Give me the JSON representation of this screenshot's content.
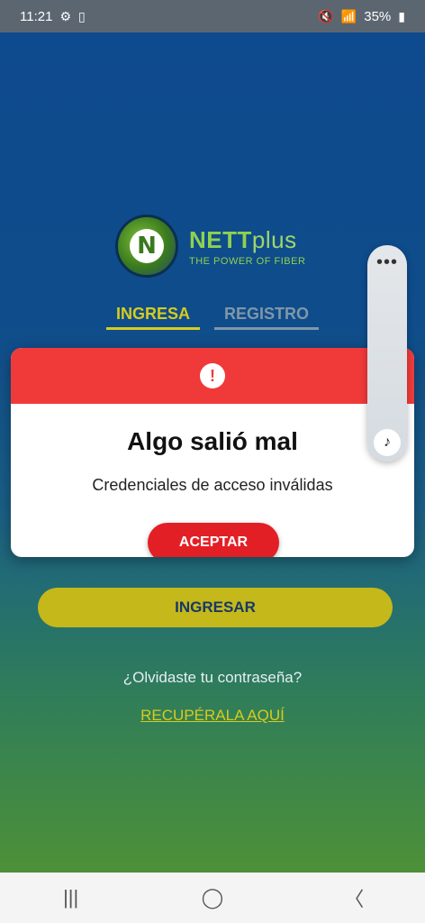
{
  "status_bar": {
    "time": "11:21",
    "settings_icon": "gear-icon",
    "sim_icon": "sim-icon",
    "mute_icon": "mute-icon",
    "wifi_icon": "wifi-icon",
    "signal_icon": "signal-icon",
    "battery_percent": "35%"
  },
  "logo": {
    "mark": "N",
    "brand_main": "NETT",
    "brand_plus": "plus",
    "tagline": "THE POWER OF FIBER"
  },
  "tabs": [
    {
      "label": "INGRESA",
      "active": true
    },
    {
      "label": "REGISTRO",
      "active": false
    }
  ],
  "dialog": {
    "icon": "!",
    "title": "Algo salió mal",
    "message": "Credenciales de acceso inválidas",
    "accept_label": "ACEPTAR",
    "header_color": "#f03a3a"
  },
  "side_panel": {
    "menu_icon": "•••",
    "music_icon": "♪"
  },
  "login": {
    "submit_label": "INGRESAR",
    "forgot_text": "¿Olvidaste tu contraseña?",
    "recover_link": "RECUPÉRALA AQUÍ"
  },
  "navbar": {
    "recents": "|||",
    "home": "◯",
    "back": "〈"
  },
  "colors": {
    "accent": "#c4b81a",
    "error": "#e31f26",
    "brand_green": "#8fd14f"
  }
}
